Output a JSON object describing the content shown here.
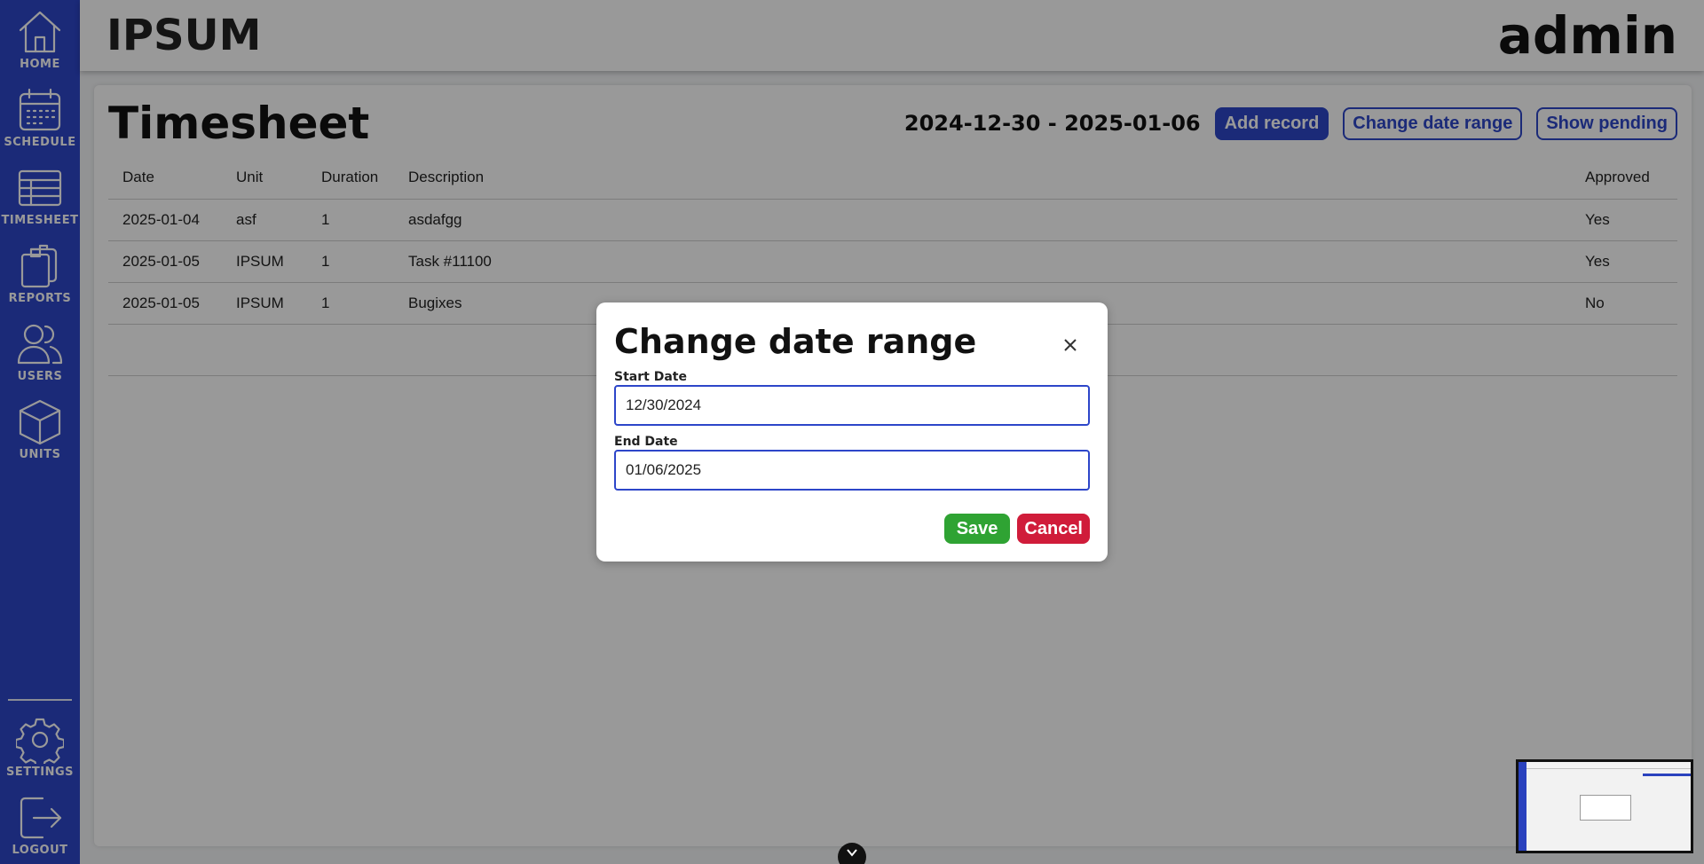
{
  "sidebar": {
    "items": [
      {
        "label": "HOME",
        "icon": "home-icon"
      },
      {
        "label": "SCHEDULE",
        "icon": "calendar-icon"
      },
      {
        "label": "TIMESHEET",
        "icon": "table-icon"
      },
      {
        "label": "REPORTS",
        "icon": "clipboard-icon"
      },
      {
        "label": "USERS",
        "icon": "users-icon"
      },
      {
        "label": "UNITS",
        "icon": "cube-icon"
      }
    ],
    "bottom_items": [
      {
        "label": "SETTINGS",
        "icon": "gear-icon"
      },
      {
        "label": "LOGOUT",
        "icon": "logout-icon"
      }
    ]
  },
  "header": {
    "app_title": "IPSUM",
    "user": "admin"
  },
  "main": {
    "title": "Timesheet",
    "date_range": "2024-12-30 - 2025-01-06",
    "buttons": {
      "add_record": "Add record",
      "change_date_range": "Change date range",
      "show_pending": "Show pending"
    },
    "table": {
      "headers": [
        "Date",
        "Unit",
        "Duration",
        "Description",
        "Approved"
      ],
      "rows": [
        [
          "2025-01-04",
          "asf",
          "1",
          "asdafgg",
          "Yes"
        ],
        [
          "2025-01-05",
          "IPSUM",
          "1",
          "Task #11100",
          "Yes"
        ],
        [
          "2025-01-05",
          "IPSUM",
          "1",
          "Bugixes",
          "No"
        ]
      ]
    }
  },
  "modal": {
    "title": "Change date range",
    "start_label": "Start Date",
    "start_value": "12/30/2024",
    "end_label": "End Date",
    "end_value": "01/06/2025",
    "save_label": "Save",
    "cancel_label": "Cancel"
  },
  "colors": {
    "brand": "#2d46c9",
    "save": "#2fa333",
    "cancel": "#d01c3a"
  }
}
